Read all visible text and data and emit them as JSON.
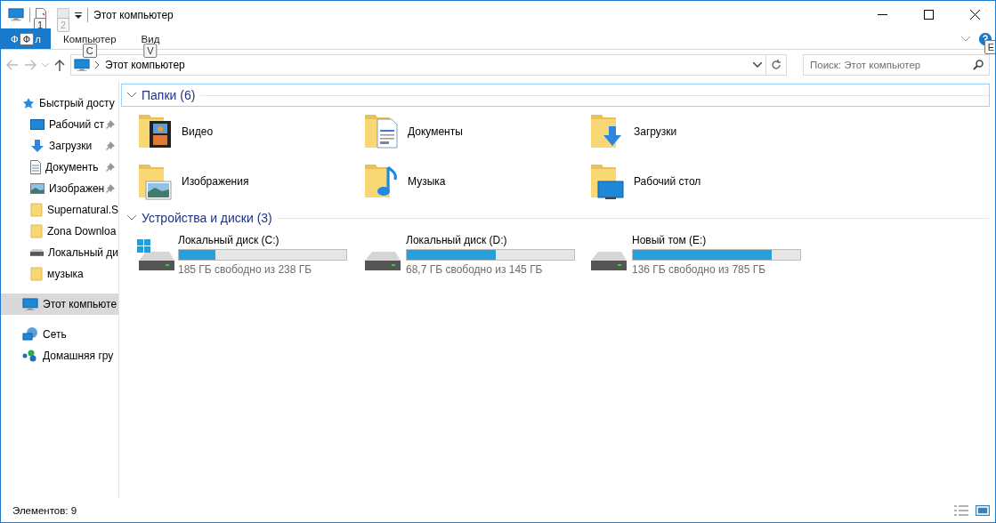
{
  "window": {
    "title": "Этот компьютер"
  },
  "quick_access_keytips": [
    "1",
    "2"
  ],
  "ribbon": {
    "file_tab": {
      "label_left": "Ф",
      "keytip": "Ф",
      "label_right": "л",
      "selected": true
    },
    "tabs": [
      {
        "label": "Компьютер",
        "keytip": "C",
        "selected": false
      },
      {
        "label": "Вид",
        "keytip": "V",
        "selected": false
      }
    ],
    "help_keytip": "E"
  },
  "address": {
    "path": "Этот компьютер"
  },
  "search": {
    "placeholder": "Поиск: Этот компьютер"
  },
  "sidebar": {
    "items": [
      {
        "label": "Быстрый досту",
        "kind": "star",
        "selected": false,
        "children": [
          {
            "label": "Рабочий ст",
            "kind": "desktop",
            "pinned": true,
            "selected": false
          },
          {
            "label": "Загрузки",
            "kind": "download",
            "pinned": true,
            "selected": false
          },
          {
            "label": "Документь",
            "kind": "document",
            "pinned": true,
            "selected": false
          },
          {
            "label": "Изображен",
            "kind": "pictures",
            "pinned": true,
            "selected": false
          },
          {
            "label": "Supernatural.S",
            "kind": "folder",
            "pinned": false,
            "selected": false
          },
          {
            "label": "Zona Downloa",
            "kind": "folder",
            "pinned": false,
            "selected": false
          },
          {
            "label": "Локальный ди",
            "kind": "drive",
            "pinned": false,
            "selected": false
          },
          {
            "label": "музыка",
            "kind": "folder",
            "pinned": false,
            "selected": false
          }
        ]
      },
      {
        "label": "Этот компьюте",
        "kind": "pc",
        "selected": true
      },
      {
        "label": "Сеть",
        "kind": "network",
        "selected": false
      },
      {
        "label": "Домашняя гру",
        "kind": "homegroup",
        "selected": false
      }
    ]
  },
  "sections": [
    {
      "title": "Папки (6)",
      "expanded": true,
      "focused": true,
      "kind": "folders",
      "items": [
        {
          "label": "Видео",
          "kind": "video"
        },
        {
          "label": "Документы",
          "kind": "documents"
        },
        {
          "label": "Загрузки",
          "kind": "downloads"
        },
        {
          "label": "Изображения",
          "kind": "pictures"
        },
        {
          "label": "Музыка",
          "kind": "music"
        },
        {
          "label": "Рабочий стол",
          "kind": "desktop"
        }
      ]
    },
    {
      "title": "Устройства и диски (3)",
      "expanded": true,
      "focused": false,
      "kind": "drives",
      "items": [
        {
          "label": "Локальный диск (C:)",
          "kind": "system",
          "level": 0.22,
          "free": "185 ГБ свободно из 238 ГБ"
        },
        {
          "label": "Локальный диск (D:)",
          "kind": "disk",
          "level": 0.53,
          "free": "68,7 ГБ свободно из 145 ГБ"
        },
        {
          "label": "Новый том (E:)",
          "kind": "disk",
          "level": 0.83,
          "free": "136 ГБ свободно из 785 ГБ"
        }
      ]
    }
  ],
  "status_bar": {
    "count": "Элементов: 9"
  }
}
